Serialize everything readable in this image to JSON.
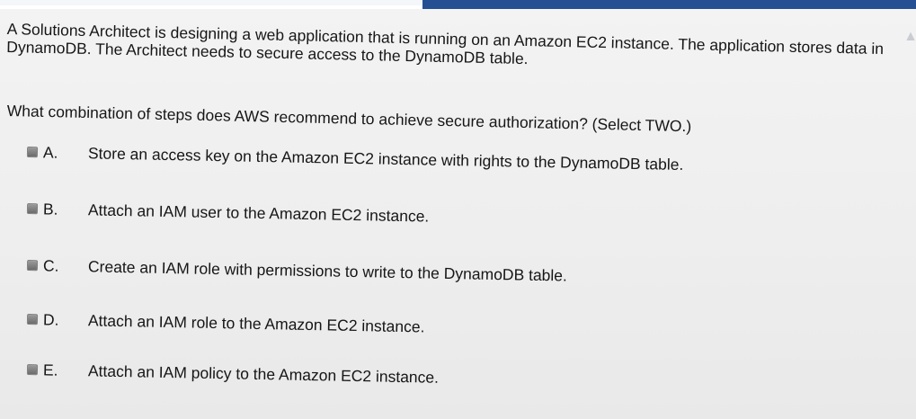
{
  "question": {
    "stem": [
      "A Solutions Architect is designing a web application that is running on an Amazon EC2 instance. The application stores data in",
      "DynamoDB. The Architect needs to secure access to the DynamoDB table."
    ],
    "prompt": "What combination of steps does AWS recommend to achieve secure authorization? (Select TWO.)"
  },
  "options": [
    {
      "letter": "A.",
      "text": "Store an access key on the Amazon EC2 instance with rights to the DynamoDB table.",
      "checked": false
    },
    {
      "letter": "B.",
      "text": "Attach an IAM user to the Amazon EC2 instance.",
      "checked": false
    },
    {
      "letter": "C.",
      "text": "Create an IAM role with permissions to write to the DynamoDB table.",
      "checked": false
    },
    {
      "letter": "D.",
      "text": "Attach an IAM role to the Amazon EC2 instance.",
      "checked": false
    },
    {
      "letter": "E.",
      "text": "Attach an IAM policy to the Amazon EC2 instance.",
      "checked": false
    }
  ],
  "colors": {
    "header_blue": "#254f93",
    "screen_bg": "#efefef",
    "text": "#161616",
    "checkbox": "#7a7a7a"
  },
  "icons": {
    "checkbox": "checkbox-icon"
  }
}
